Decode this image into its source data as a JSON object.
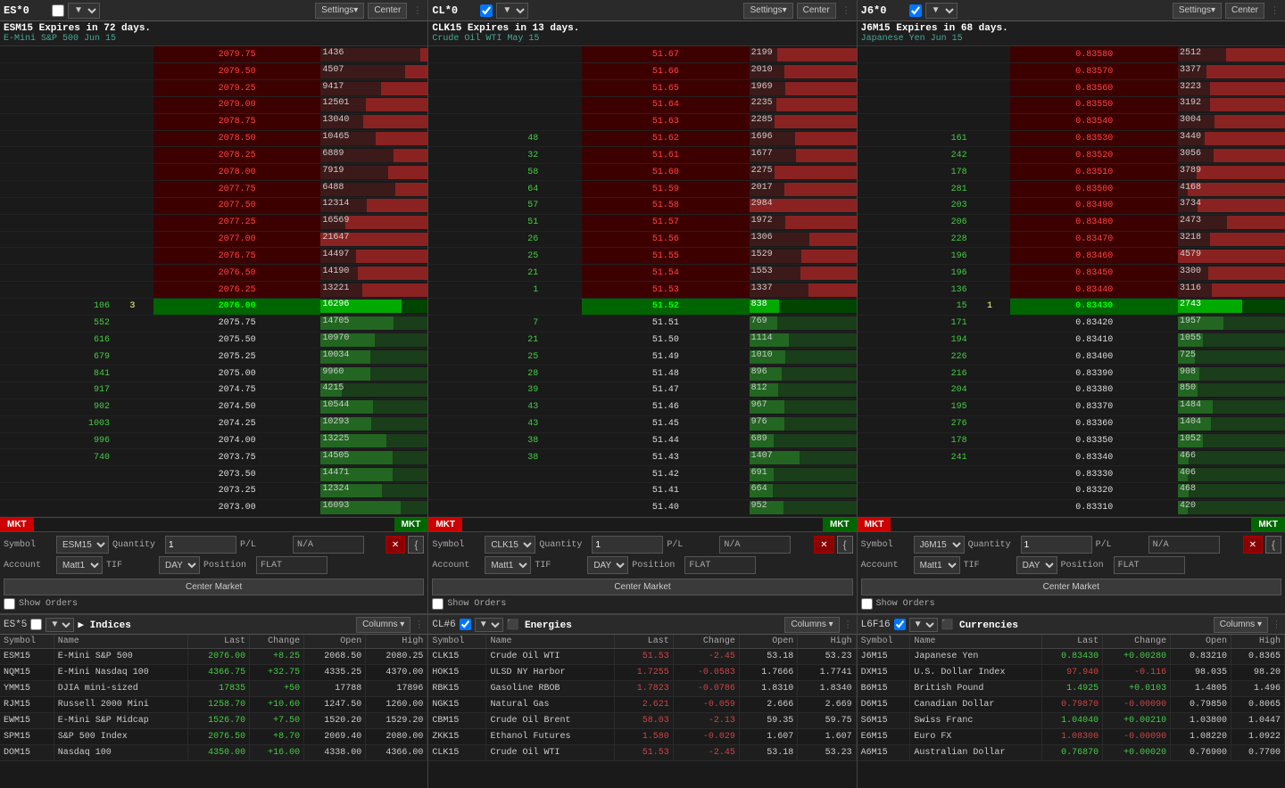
{
  "panels": {
    "ladder1": {
      "symbol": "ES*0",
      "title": "ESM15 Expires in 72 days.",
      "subtitle": "E-Mini S&P 500 Jun 15",
      "settings_label": "Settings▾",
      "center_label": "Center",
      "rows": [
        {
          "bid": "",
          "pos": "",
          "price": "2079.75",
          "ask": "1436",
          "side": "ask"
        },
        {
          "bid": "",
          "pos": "",
          "price": "2079.50",
          "ask": "4507",
          "side": "ask"
        },
        {
          "bid": "",
          "pos": "",
          "price": "2079.25",
          "ask": "9417",
          "side": "ask"
        },
        {
          "bid": "",
          "pos": "",
          "price": "2079.00",
          "ask": "12501",
          "side": "ask"
        },
        {
          "bid": "",
          "pos": "",
          "price": "2078.75",
          "ask": "13040",
          "side": "ask"
        },
        {
          "bid": "",
          "pos": "",
          "price": "2078.50",
          "ask": "10465",
          "side": "ask"
        },
        {
          "bid": "",
          "pos": "",
          "price": "2078.25",
          "ask": "6889",
          "side": "ask"
        },
        {
          "bid": "",
          "pos": "",
          "price": "2078.00",
          "ask": "7919",
          "side": "ask"
        },
        {
          "bid": "",
          "pos": "",
          "price": "2077.75",
          "ask": "6488",
          "side": "ask"
        },
        {
          "bid": "",
          "pos": "",
          "price": "2077.50",
          "ask": "12314",
          "side": "ask"
        },
        {
          "bid": "",
          "pos": "",
          "price": "2077.25",
          "ask": "16569",
          "side": "ask"
        },
        {
          "bid": "",
          "pos": "",
          "price": "2077.00",
          "ask": "21647",
          "side": "ask"
        },
        {
          "bid": "",
          "pos": "",
          "price": "2076.75",
          "ask": "14497",
          "side": "ask"
        },
        {
          "bid": "",
          "pos": "",
          "price": "2076.50",
          "ask": "14190",
          "side": "ask"
        },
        {
          "bid": "",
          "pos": "",
          "price": "2076.25",
          "ask": "13221",
          "side": "ask"
        },
        {
          "bid": "106",
          "pos": "3",
          "price": "2076.00",
          "ask": "16296",
          "side": "current"
        },
        {
          "bid": "552",
          "pos": "",
          "price": "2075.75",
          "ask": "14705",
          "side": "bid"
        },
        {
          "bid": "616",
          "pos": "",
          "price": "2075.50",
          "ask": "10970",
          "side": "bid"
        },
        {
          "bid": "679",
          "pos": "",
          "price": "2075.25",
          "ask": "10034",
          "side": "bid"
        },
        {
          "bid": "841",
          "pos": "",
          "price": "2075.00",
          "ask": "9960",
          "side": "bid"
        },
        {
          "bid": "917",
          "pos": "",
          "price": "2074.75",
          "ask": "4215",
          "side": "bid"
        },
        {
          "bid": "902",
          "pos": "",
          "price": "2074.50",
          "ask": "10544",
          "side": "bid"
        },
        {
          "bid": "1003",
          "pos": "",
          "price": "2074.25",
          "ask": "10293",
          "side": "bid"
        },
        {
          "bid": "996",
          "pos": "",
          "price": "2074.00",
          "ask": "13225",
          "side": "bid"
        },
        {
          "bid": "740",
          "pos": "",
          "price": "2073.75",
          "ask": "14505",
          "side": "bid"
        },
        {
          "bid": "",
          "pos": "",
          "price": "2073.50",
          "ask": "14471",
          "side": "bid"
        },
        {
          "bid": "",
          "pos": "",
          "price": "2073.25",
          "ask": "12324",
          "side": "bid"
        },
        {
          "bid": "",
          "pos": "",
          "price": "2073.00",
          "ask": "16093",
          "side": "bid"
        }
      ],
      "order": {
        "symbol": "ESM15",
        "quantity": "1",
        "pnl": "N/A",
        "account": "Matt1",
        "tif": "DAY",
        "position": "FLAT",
        "show_orders": "Show Orders",
        "center_market": "Center Market"
      }
    },
    "ladder2": {
      "symbol": "CL*0",
      "title": "CLK15 Expires in 13 days.",
      "subtitle": "Crude Oil WTI May 15",
      "settings_label": "Settings▾",
      "center_label": "Center",
      "rows": [
        {
          "bid": "",
          "pos": "",
          "price": "51.67",
          "ask": "2199",
          "side": "ask"
        },
        {
          "bid": "",
          "pos": "",
          "price": "51.66",
          "ask": "2010",
          "side": "ask"
        },
        {
          "bid": "",
          "pos": "",
          "price": "51.65",
          "ask": "1969",
          "side": "ask"
        },
        {
          "bid": "",
          "pos": "",
          "price": "51.64",
          "ask": "2235",
          "side": "ask"
        },
        {
          "bid": "",
          "pos": "",
          "price": "51.63",
          "ask": "2285",
          "side": "ask"
        },
        {
          "bid": "48",
          "pos": "",
          "price": "51.62",
          "ask": "1696",
          "side": "ask"
        },
        {
          "bid": "32",
          "pos": "",
          "price": "51.61",
          "ask": "1677",
          "side": "ask"
        },
        {
          "bid": "58",
          "pos": "",
          "price": "51.60",
          "ask": "2275",
          "side": "ask"
        },
        {
          "bid": "64",
          "pos": "",
          "price": "51.59",
          "ask": "2017",
          "side": "ask"
        },
        {
          "bid": "57",
          "pos": "",
          "price": "51.58",
          "ask": "2984",
          "side": "ask"
        },
        {
          "bid": "51",
          "pos": "",
          "price": "51.57",
          "ask": "1972",
          "side": "ask"
        },
        {
          "bid": "26",
          "pos": "",
          "price": "51.56",
          "ask": "1306",
          "side": "ask"
        },
        {
          "bid": "25",
          "pos": "",
          "price": "51.55",
          "ask": "1529",
          "side": "ask"
        },
        {
          "bid": "21",
          "pos": "",
          "price": "51.54",
          "ask": "1553",
          "side": "ask"
        },
        {
          "bid": "1",
          "pos": "",
          "price": "51.53",
          "ask": "1337",
          "side": "ask"
        },
        {
          "bid": "",
          "pos": "",
          "price": "51.52",
          "ask": "838",
          "side": "current"
        },
        {
          "bid": "7",
          "pos": "",
          "price": "51.51",
          "ask": "769",
          "side": "bid"
        },
        {
          "bid": "21",
          "pos": "",
          "price": "51.50",
          "ask": "1114",
          "side": "bid"
        },
        {
          "bid": "25",
          "pos": "",
          "price": "51.49",
          "ask": "1010",
          "side": "bid"
        },
        {
          "bid": "28",
          "pos": "",
          "price": "51.48",
          "ask": "896",
          "side": "bid"
        },
        {
          "bid": "39",
          "pos": "",
          "price": "51.47",
          "ask": "812",
          "side": "bid"
        },
        {
          "bid": "43",
          "pos": "",
          "price": "51.46",
          "ask": "967",
          "side": "bid"
        },
        {
          "bid": "43",
          "pos": "",
          "price": "51.45",
          "ask": "976",
          "side": "bid"
        },
        {
          "bid": "38",
          "pos": "",
          "price": "51.44",
          "ask": "689",
          "side": "bid"
        },
        {
          "bid": "38",
          "pos": "",
          "price": "51.43",
          "ask": "1407",
          "side": "bid"
        },
        {
          "bid": "",
          "pos": "",
          "price": "51.42",
          "ask": "691",
          "side": "bid"
        },
        {
          "bid": "",
          "pos": "",
          "price": "51.41",
          "ask": "664",
          "side": "bid"
        },
        {
          "bid": "",
          "pos": "",
          "price": "51.40",
          "ask": "952",
          "side": "bid"
        }
      ],
      "order": {
        "symbol": "CLK15",
        "quantity": "1",
        "pnl": "N/A",
        "account": "Matt1",
        "tif": "DAY",
        "position": "FLAT",
        "show_orders": "Show Orders",
        "center_market": "Center Market"
      }
    },
    "ladder3": {
      "symbol": "J6*0",
      "title": "J6M15 Expires in 68 days.",
      "subtitle": "Japanese Yen Jun 15",
      "settings_label": "Settings▾",
      "center_label": "Center",
      "rows": [
        {
          "bid": "",
          "pos": "",
          "price": "0.83580",
          "ask": "2512",
          "side": "ask"
        },
        {
          "bid": "",
          "pos": "",
          "price": "0.83570",
          "ask": "3377",
          "side": "ask"
        },
        {
          "bid": "",
          "pos": "",
          "price": "0.83560",
          "ask": "3223",
          "side": "ask"
        },
        {
          "bid": "",
          "pos": "",
          "price": "0.83550",
          "ask": "3192",
          "side": "ask"
        },
        {
          "bid": "",
          "pos": "",
          "price": "0.83540",
          "ask": "3004",
          "side": "ask"
        },
        {
          "bid": "161",
          "pos": "",
          "price": "0.83530",
          "ask": "3440",
          "side": "ask"
        },
        {
          "bid": "242",
          "pos": "",
          "price": "0.83520",
          "ask": "3056",
          "side": "ask"
        },
        {
          "bid": "178",
          "pos": "",
          "price": "0.83510",
          "ask": "3789",
          "side": "ask"
        },
        {
          "bid": "281",
          "pos": "",
          "price": "0.83500",
          "ask": "4168",
          "side": "ask"
        },
        {
          "bid": "203",
          "pos": "",
          "price": "0.83490",
          "ask": "3734",
          "side": "ask"
        },
        {
          "bid": "206",
          "pos": "",
          "price": "0.83480",
          "ask": "2473",
          "side": "ask"
        },
        {
          "bid": "228",
          "pos": "",
          "price": "0.83470",
          "ask": "3218",
          "side": "ask"
        },
        {
          "bid": "196",
          "pos": "",
          "price": "0.83460",
          "ask": "4579",
          "side": "ask"
        },
        {
          "bid": "196",
          "pos": "",
          "price": "0.83450",
          "ask": "3300",
          "side": "ask"
        },
        {
          "bid": "136",
          "pos": "",
          "price": "0.83440",
          "ask": "3116",
          "side": "ask"
        },
        {
          "bid": "15",
          "pos": "1",
          "price": "0.83430",
          "ask": "2743",
          "side": "current"
        },
        {
          "bid": "171",
          "pos": "",
          "price": "0.83420",
          "ask": "1957",
          "side": "bid"
        },
        {
          "bid": "194",
          "pos": "",
          "price": "0.83410",
          "ask": "1055",
          "side": "bid"
        },
        {
          "bid": "226",
          "pos": "",
          "price": "0.83400",
          "ask": "725",
          "side": "bid"
        },
        {
          "bid": "216",
          "pos": "",
          "price": "0.83390",
          "ask": "908",
          "side": "bid"
        },
        {
          "bid": "204",
          "pos": "",
          "price": "0.83380",
          "ask": "850",
          "side": "bid"
        },
        {
          "bid": "195",
          "pos": "",
          "price": "0.83370",
          "ask": "1484",
          "side": "bid"
        },
        {
          "bid": "276",
          "pos": "",
          "price": "0.83360",
          "ask": "1404",
          "side": "bid"
        },
        {
          "bid": "178",
          "pos": "",
          "price": "0.83350",
          "ask": "1052",
          "side": "bid"
        },
        {
          "bid": "241",
          "pos": "",
          "price": "0.83340",
          "ask": "466",
          "side": "bid"
        },
        {
          "bid": "",
          "pos": "",
          "price": "0.83330",
          "ask": "406",
          "side": "bid"
        },
        {
          "bid": "",
          "pos": "",
          "price": "0.83320",
          "ask": "468",
          "side": "bid"
        },
        {
          "bid": "",
          "pos": "",
          "price": "0.83310",
          "ask": "420",
          "side": "bid"
        }
      ],
      "order": {
        "symbol": "J6M15",
        "quantity": "1",
        "pnl": "N/A",
        "account": "Matt1",
        "tif": "DAY",
        "position": "FLAT",
        "show_orders": "Show Orders",
        "center_market": "Center Market"
      }
    }
  },
  "lists": {
    "indices": {
      "label": "▶ Indices",
      "symbol": "ES*5",
      "columns_label": "Columns ▾",
      "headers": [
        "Symbol",
        "Name",
        "Last",
        "Change",
        "Open",
        "High"
      ],
      "rows": [
        {
          "symbol": "ESM15",
          "name": "E-Mini S&P 500",
          "last": "2076.00",
          "change": "+8.25",
          "change_sign": 1,
          "open": "2068.50",
          "high": "2080.25"
        },
        {
          "symbol": "NQM15",
          "name": "E-Mini Nasdaq 100",
          "last": "4366.75",
          "change": "+32.75",
          "change_sign": 1,
          "open": "4335.25",
          "high": "4370.00"
        },
        {
          "symbol": "YMM15",
          "name": "DJIA mini-sized",
          "last": "17835",
          "change": "+50",
          "change_sign": 1,
          "open": "17788",
          "high": "17896"
        },
        {
          "symbol": "RJM15",
          "name": "Russell 2000 Mini",
          "last": "1258.70",
          "change": "+10.60",
          "change_sign": 1,
          "open": "1247.50",
          "high": "1260.00"
        },
        {
          "symbol": "EWM15",
          "name": "E-Mini S&P Midcap",
          "last": "1526.70",
          "change": "+7.50",
          "change_sign": 1,
          "open": "1520.20",
          "high": "1529.20"
        },
        {
          "symbol": "SPM15",
          "name": "S&P 500 Index",
          "last": "2076.50",
          "change": "+8.70",
          "change_sign": 1,
          "open": "2069.40",
          "high": "2080.00"
        },
        {
          "symbol": "DOM15",
          "name": "Nasdaq 100",
          "last": "4350.00",
          "change": "+16.00",
          "change_sign": 1,
          "open": "4338.00",
          "high": "4366.00"
        }
      ]
    },
    "energies": {
      "label": "⬛ Energies",
      "symbol": "CL#6",
      "columns_label": "Columns ▾",
      "headers": [
        "Symbol",
        "Name",
        "Last",
        "Change",
        "Open",
        "High"
      ],
      "rows": [
        {
          "symbol": "CLK15",
          "name": "Crude Oil WTI",
          "last": "51.53",
          "change": "-2.45",
          "change_sign": -1,
          "open": "53.18",
          "high": "53.23"
        },
        {
          "symbol": "HOK15",
          "name": "ULSD NY Harbor",
          "last": "1.7255",
          "change": "-0.0583",
          "change_sign": -1,
          "open": "1.7666",
          "high": "1.7741"
        },
        {
          "symbol": "RBK15",
          "name": "Gasoline RBOB",
          "last": "1.7823",
          "change": "-0.0786",
          "change_sign": -1,
          "open": "1.8310",
          "high": "1.8340"
        },
        {
          "symbol": "NGK15",
          "name": "Natural Gas",
          "last": "2.621",
          "change": "-0.059",
          "change_sign": -1,
          "open": "2.666",
          "high": "2.669"
        },
        {
          "symbol": "CBM15",
          "name": "Crude Oil Brent",
          "last": "58.03",
          "change": "-2.13",
          "change_sign": -1,
          "open": "59.35",
          "high": "59.75"
        },
        {
          "symbol": "ZKK15",
          "name": "Ethanol Futures",
          "last": "1.580",
          "change": "-0.029",
          "change_sign": -1,
          "open": "1.607",
          "high": "1.607"
        },
        {
          "symbol": "CLK15",
          "name": "Crude Oil WTI",
          "last": "51.53",
          "change": "-2.45",
          "change_sign": -1,
          "open": "53.18",
          "high": "53.23"
        }
      ]
    },
    "currencies": {
      "label": "⬛ Currencies",
      "symbol": "L6F16",
      "columns_label": "Columns ▾",
      "headers": [
        "Symbol",
        "Name",
        "Last",
        "Change",
        "Open",
        "High"
      ],
      "rows": [
        {
          "symbol": "J6M15",
          "name": "Japanese Yen",
          "last": "0.83430",
          "change": "+0.00280",
          "change_sign": 1,
          "open": "0.83210",
          "high": "0.8365"
        },
        {
          "symbol": "DXM15",
          "name": "U.S. Dollar Index",
          "last": "97.940",
          "change": "-0.116",
          "change_sign": -1,
          "open": "98.035",
          "high": "98.20"
        },
        {
          "symbol": "B6M15",
          "name": "British Pound",
          "last": "1.4925",
          "change": "+0.0103",
          "change_sign": 1,
          "open": "1.4805",
          "high": "1.496"
        },
        {
          "symbol": "D6M15",
          "name": "Canadian Dollar",
          "last": "0.79870",
          "change": "-0.00090",
          "change_sign": -1,
          "open": "0.79850",
          "high": "0.8065"
        },
        {
          "symbol": "S6M15",
          "name": "Swiss Franc",
          "last": "1.04040",
          "change": "+0.00210",
          "change_sign": 1,
          "open": "1.03800",
          "high": "1.0447"
        },
        {
          "symbol": "E6M15",
          "name": "Euro FX",
          "last": "1.08300",
          "change": "-0.00090",
          "change_sign": -1,
          "open": "1.08220",
          "high": "1.0922"
        },
        {
          "symbol": "A6M15",
          "name": "Australian Dollar",
          "last": "0.76870",
          "change": "+0.00020",
          "change_sign": 1,
          "open": "0.76900",
          "high": "0.7700"
        }
      ]
    }
  },
  "labels": {
    "symbol": "Symbol",
    "quantity": "Quantity",
    "pl": "P/L",
    "account": "Account",
    "tif": "TIF",
    "position": "Position",
    "mkt": "MKT",
    "show_orders": "Show Orders",
    "center_market": "Center Market",
    "columns": "Columns ▾",
    "day": "DAY",
    "flat": "FLAT",
    "settings": "Settings▾",
    "center": "Center"
  }
}
